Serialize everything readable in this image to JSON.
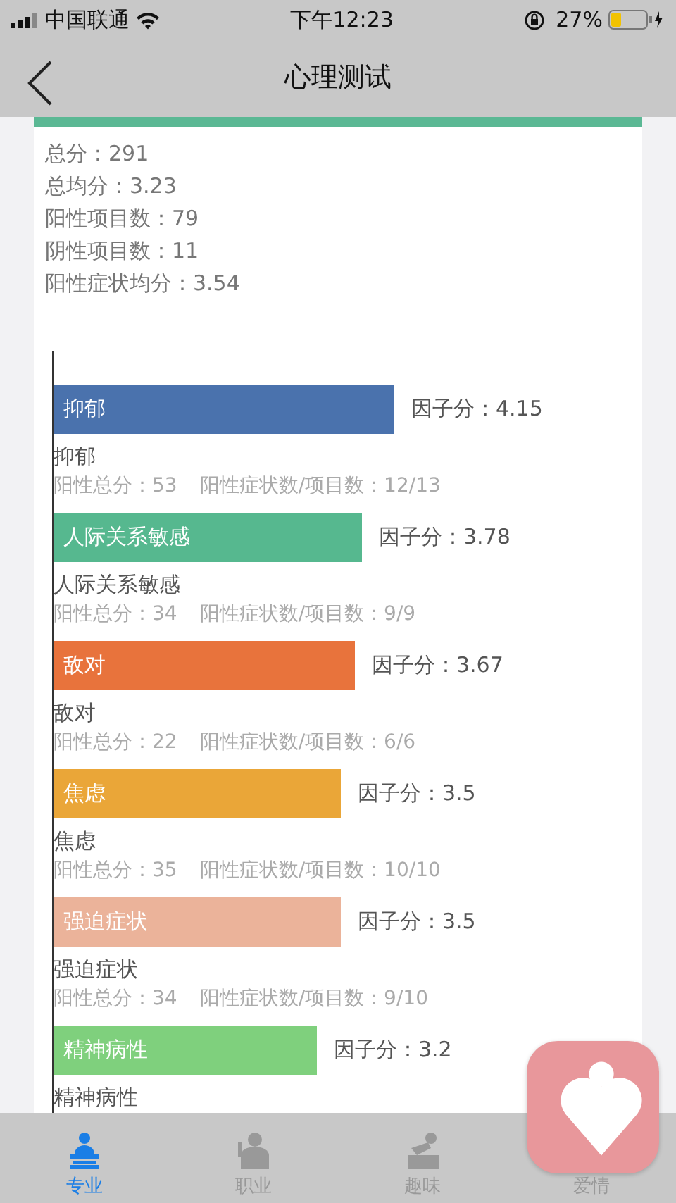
{
  "status_bar": {
    "carrier": "中国联通",
    "time": "下午12:23",
    "battery": "27%"
  },
  "header": {
    "title": "心理测试"
  },
  "summary": [
    "总分：291",
    "总均分：3.23",
    "阳性项目数：79",
    "阴性项目数：11",
    "阳性症状均分：3.54"
  ],
  "factors": [
    {
      "name": "抑郁",
      "color": "#4a72ad",
      "score": "因子分：4.15",
      "label": "抑郁",
      "total": "阳性总分：53",
      "ratio": "阳性症状数/项目数：12/13"
    },
    {
      "name": "人际关系敏感",
      "color": "#56b88f",
      "score": "因子分：3.78",
      "label": "人际关系敏感",
      "total": "阳性总分：34",
      "ratio": "阳性症状数/项目数：9/9"
    },
    {
      "name": "敌对",
      "color": "#e8733c",
      "score": "因子分：3.67",
      "label": "敌对",
      "total": "阳性总分：22",
      "ratio": "阳性症状数/项目数：6/6"
    },
    {
      "name": "焦虑",
      "color": "#eaa638",
      "score": "因子分：3.5",
      "label": "焦虑",
      "total": "阳性总分：35",
      "ratio": "阳性症状数/项目数：10/10"
    },
    {
      "name": "强迫症状",
      "color": "#ebb39a",
      "score": "因子分：3.5",
      "label": "强迫症状",
      "total": "阳性总分：34",
      "ratio": "阳性症状数/项目数：9/10"
    },
    {
      "name": "精神病性",
      "color": "#7fd07d",
      "score": "因子分：3.2",
      "label": "精神病性"
    }
  ],
  "tabs": [
    {
      "label": "专业",
      "kind": "podium",
      "selected": true
    },
    {
      "label": "职业",
      "kind": "suit",
      "selected": false
    },
    {
      "label": "趣味",
      "kind": "desk",
      "selected": false
    },
    {
      "label": "爱情",
      "selected": false
    }
  ]
}
